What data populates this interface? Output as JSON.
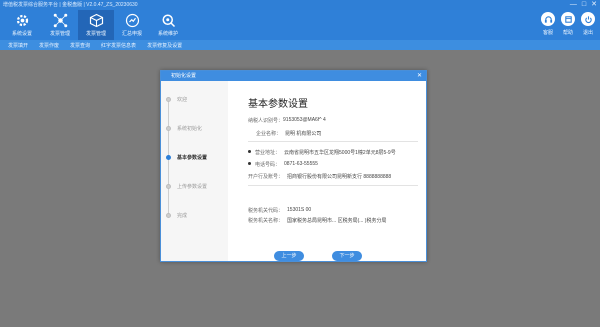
{
  "window": {
    "title": "增值税发票综合服务平台 | 金税盘版 | V2.0.47_ZS_20230630",
    "controls": [
      "—",
      "□",
      "✕"
    ]
  },
  "toolbar": {
    "left": [
      {
        "label": "系统设置",
        "icon": "gear-icon"
      },
      {
        "label": "发票管理",
        "icon": "share-nodes-icon"
      },
      {
        "label": "发票管理",
        "icon": "box-icon"
      },
      {
        "label": "汇总申报",
        "icon": "shield-chart-icon"
      },
      {
        "label": "系统维护",
        "icon": "gear-search-icon"
      }
    ],
    "right": [
      {
        "label": "客服",
        "icon": "headset-icon"
      },
      {
        "label": "帮助",
        "icon": "help-icon"
      },
      {
        "label": "退出",
        "icon": "power-icon"
      }
    ]
  },
  "subnav": [
    "发票填开",
    "发票作废",
    "发票查询",
    "红字发票信息表",
    "发票修复及设置"
  ],
  "dialog": {
    "title": "初始化设置",
    "close": "✕",
    "steps": [
      "欢迎",
      "系统初始化",
      "基本参数设置",
      "上传参数设置",
      "完成"
    ],
    "current_step": 2,
    "form": {
      "heading": "基本参数设置",
      "tax_id_label": "纳税人识别号：",
      "tax_id_value": "9153053@MA6f^ 4",
      "company_label": "企业名称：",
      "company_value": "昆明      机有限公司",
      "address_label": "营业地址：",
      "address_value": "云南省昆明市五华区龙翔5000号1幢2单元8层5-9号",
      "phone_label": "电话号码：",
      "phone_value": "0871-63-55555",
      "bank_label": "开户行及账号：",
      "bank_value": "招商银行股份有限公司昆明新支行 8888888888",
      "authority_code_label": "税务机关代码：",
      "authority_code_value": "15301S     00",
      "authority_name_label": "税务机关名称：",
      "authority_name_value": "国家税务总局昆明市... 区税务局(... )税务分局"
    },
    "buttons": {
      "prev": "上一步",
      "next": "下一步"
    }
  },
  "colors": {
    "accent": "#2f80d8",
    "toolbar_active": "#2366b7",
    "backdrop": "#7a7a7a"
  }
}
